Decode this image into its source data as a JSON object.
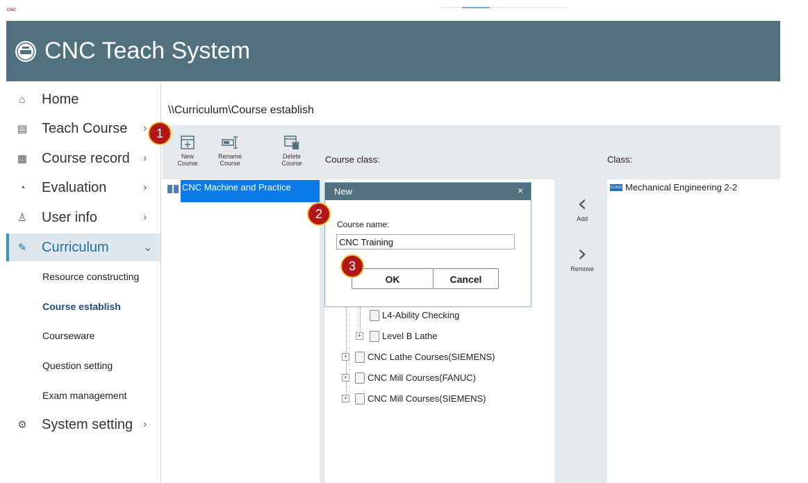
{
  "app": {
    "mini_logo_text": "CNC",
    "title": "CNC Teach System"
  },
  "sidebar": {
    "items": [
      {
        "label": "Home",
        "icon": "home-icon",
        "glyph": "⌂",
        "chevron": ""
      },
      {
        "label": "Teach Course",
        "icon": "teach-course-icon",
        "glyph": "▤",
        "chevron": "›"
      },
      {
        "label": "Course record",
        "icon": "course-record-icon",
        "glyph": "▦",
        "chevron": "›"
      },
      {
        "label": "Evaluation",
        "icon": "evaluation-icon",
        "glyph": "◔",
        "chevron": "›"
      },
      {
        "label": "User info",
        "icon": "user-icon",
        "glyph": "♙",
        "chevron": "›"
      },
      {
        "label": "Curriculum",
        "icon": "pencil-icon",
        "glyph": "✎",
        "chevron": "⌄"
      },
      {
        "label": "System setting",
        "icon": "gear-icon",
        "glyph": "⚙",
        "chevron": "›"
      }
    ],
    "sub_items": [
      {
        "label": "Resource constructing"
      },
      {
        "label": "Course establish"
      },
      {
        "label": "Courseware"
      },
      {
        "label": "Question setting"
      },
      {
        "label": "Exam management"
      }
    ]
  },
  "breadcrumb": "\\\\Curriculum\\Course establish",
  "toolbar": {
    "new_line1": "New",
    "new_line2": "Course",
    "rename_line1": "Rename",
    "rename_line2": "Course",
    "delete_line1": "Delete",
    "delete_line2": "Course"
  },
  "sections": {
    "course_class": "Course class:",
    "class": "Class:"
  },
  "left_list": {
    "selected_course": "CNC Machine and Practice"
  },
  "tree": {
    "items": [
      {
        "label": "L4-Ability Checking"
      },
      {
        "label": "Level B Lathe"
      },
      {
        "label": "CNC Lathe Courses(SIEMENS)"
      },
      {
        "label": "CNC Mill Courses(FANUC)"
      },
      {
        "label": "CNC Mill Courses(SIEMENS)"
      }
    ]
  },
  "transfer": {
    "add_label": "Add",
    "remove_label": "Remove"
  },
  "class_list": {
    "badge": "CLASS",
    "item": "Mechanical Engineering 2-2"
  },
  "dialog": {
    "title": "New",
    "close": "×",
    "label": "Course name:",
    "value": "CNC Training",
    "ok": "OK",
    "cancel": "Cancel"
  },
  "callouts": {
    "one": "1",
    "two": "2",
    "three": "3"
  },
  "colors": {
    "header": "#51717f",
    "selection": "#0a7be6",
    "accent": "#2f96c8",
    "callout": "#b01717"
  }
}
